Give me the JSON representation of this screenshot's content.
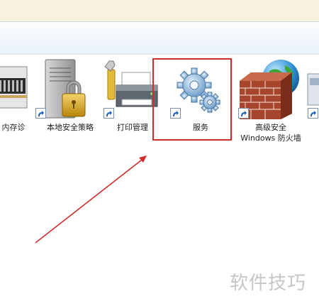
{
  "window": {
    "accent_frame": "#d22b2b",
    "header_gradient": [
      "#fdfefe",
      "#e9f1fa"
    ]
  },
  "items": [
    {
      "id": "memory",
      "label_line1": "内存诊",
      "label_line2": "",
      "icon": "memory-chip-icon"
    },
    {
      "id": "local-security",
      "label_line1": "本地安全策略",
      "label_line2": "",
      "icon": "security-policy-icon"
    },
    {
      "id": "print",
      "label_line1": "打印管理",
      "label_line2": "",
      "icon": "printer-icon"
    },
    {
      "id": "services",
      "label_line1": "服务",
      "label_line2": "",
      "icon": "gears-icon"
    },
    {
      "id": "firewall",
      "label_line1": "高级安全",
      "label_line2": "Windows 防火墙",
      "icon": "firewall-icon"
    }
  ],
  "annotation": {
    "type": "red-arrow",
    "color": "#d22b2b",
    "target": "services"
  },
  "watermark": {
    "text": "软件技巧"
  }
}
